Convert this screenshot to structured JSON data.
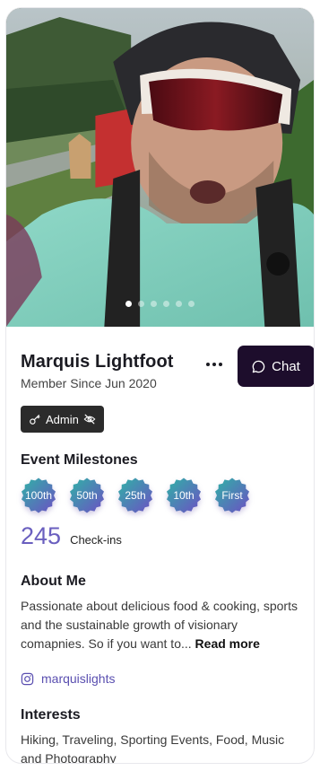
{
  "profile": {
    "name": "Marquis Lightfoot",
    "member_since": "Member Since Jun 2020",
    "chat_label": "Chat",
    "admin_label": "Admin"
  },
  "gallery": {
    "dots_total": 6,
    "active_index": 0
  },
  "milestones": {
    "title": "Event Milestones",
    "badges": [
      "100th",
      "50th",
      "25th",
      "10th",
      "First"
    ],
    "checkins_count": "245",
    "checkins_label": "Check-ins"
  },
  "about": {
    "title": "About Me",
    "text": "Passionate about delicious food & cooking, sports and the sustainable growth of visionary comapnies. So if you want to... ",
    "read_more": "Read more"
  },
  "social": {
    "instagram_handle": "marquislights",
    "icon": "instagram-icon"
  },
  "interests": {
    "title": "Interests",
    "text": "Hiking, Traveling, Sporting Events, Food, Music and Photography"
  },
  "colors": {
    "chat_button": "#1d0d2c",
    "accent": "#6a5fbf",
    "badge_gradient_start": "#2fb3a6",
    "badge_gradient_end": "#6d4fc4"
  }
}
